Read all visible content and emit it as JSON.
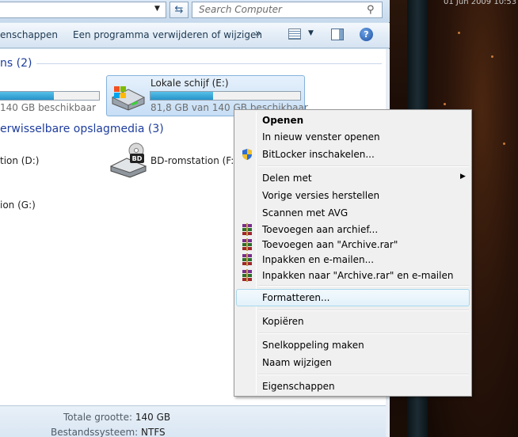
{
  "desktop": {
    "clock_text": "01 Jun 2009 10:53"
  },
  "address": {
    "search_placeholder": "Search Computer"
  },
  "toolbar": {
    "properties_label": "enschappen",
    "uninstall_label": "Een programma verwijderen of wijzigen",
    "more_label": "»",
    "help_label": "?"
  },
  "groups": {
    "hdd_header": "ns (2)",
    "removable_header": "erwisselbare opslagmedia (3)"
  },
  "drives": {
    "c_free_text": "140 GB beschikbaar",
    "c_fill_percent": 55,
    "e_name": "Lokale schijf (E:)",
    "e_free_text": "81,8 GB van 140 GB beschikbaar",
    "e_fill_percent": 42,
    "d_name": "tion (D:)",
    "f_name": "BD-romstation (F:)",
    "g_name": "ion (G:)"
  },
  "details": {
    "total_size_label": "Totale grootte:",
    "total_size_value": "140 GB",
    "filesystem_label": "Bestandssysteem:",
    "filesystem_value": "NTFS"
  },
  "context_menu": {
    "items": [
      {
        "label": "Openen"
      },
      {
        "label": "In nieuw venster openen"
      },
      {
        "label": "BitLocker inschakelen..."
      },
      {
        "label": "Delen met"
      },
      {
        "label": "Vorige versies herstellen"
      },
      {
        "label": "Scannen met AVG"
      },
      {
        "label": "Toevoegen aan archief..."
      },
      {
        "label": "Toevoegen aan \"Archive.rar\""
      },
      {
        "label": "Inpakken en e-mailen..."
      },
      {
        "label": "Inpakken naar \"Archive.rar\" en e-mailen"
      },
      {
        "label": "Formatteren..."
      },
      {
        "label": "Kopiëren"
      },
      {
        "label": "Snelkoppeling maken"
      },
      {
        "label": "Naam wijzigen"
      },
      {
        "label": "Eigenschappen"
      }
    ]
  },
  "colors": {
    "accent": "#1e3d9e",
    "bar_fill": "#2694c9",
    "highlight": "#a8d8eb"
  }
}
